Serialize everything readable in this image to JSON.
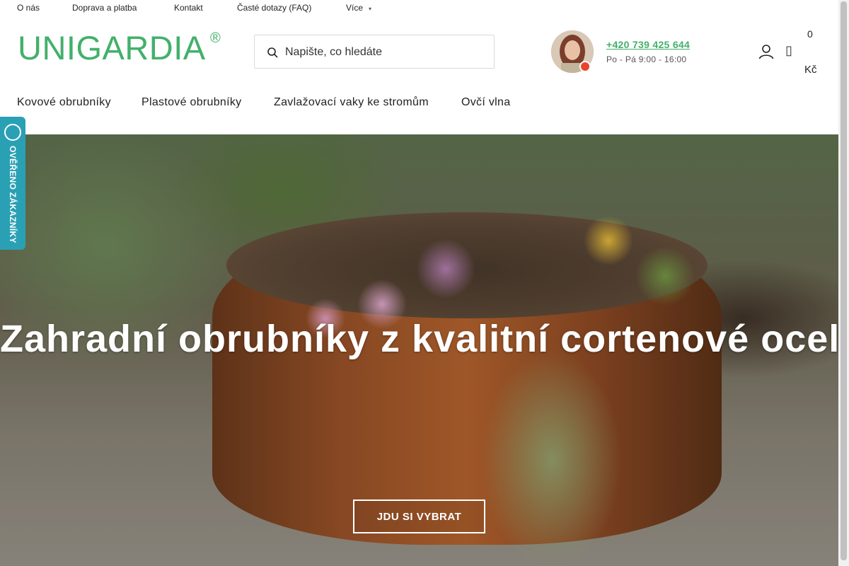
{
  "topbar": {
    "links": [
      "O nás",
      "Doprava a platba",
      "Kontakt",
      "Časté dotazy (FAQ)",
      "Více"
    ]
  },
  "header": {
    "logo_text": "UNIGARDIA",
    "logo_reg": "®",
    "search_placeholder": "Napište, co hledáte",
    "phone": "+420 739 425 644",
    "hours": "Po - Pá 9:00 - 16:00",
    "cart_count": "0",
    "cart_currency": "Kč"
  },
  "mainnav": {
    "items": [
      "Kovové obrubníky",
      "Plastové obrubníky",
      "Zavlažovací vaky ke stromům",
      "Ovčí vlna"
    ]
  },
  "hero": {
    "title": "Zahradní obrubníky z kvalitní cortenové oceli",
    "button_label": "JDU SI VYBRAT"
  },
  "verified_badge": {
    "label": "OVĚŘENO ZÁKAZNÍKY"
  },
  "colors": {
    "brand_green": "#43b06b",
    "badge_teal": "#2aa0b4",
    "status_red": "#e8452c"
  }
}
